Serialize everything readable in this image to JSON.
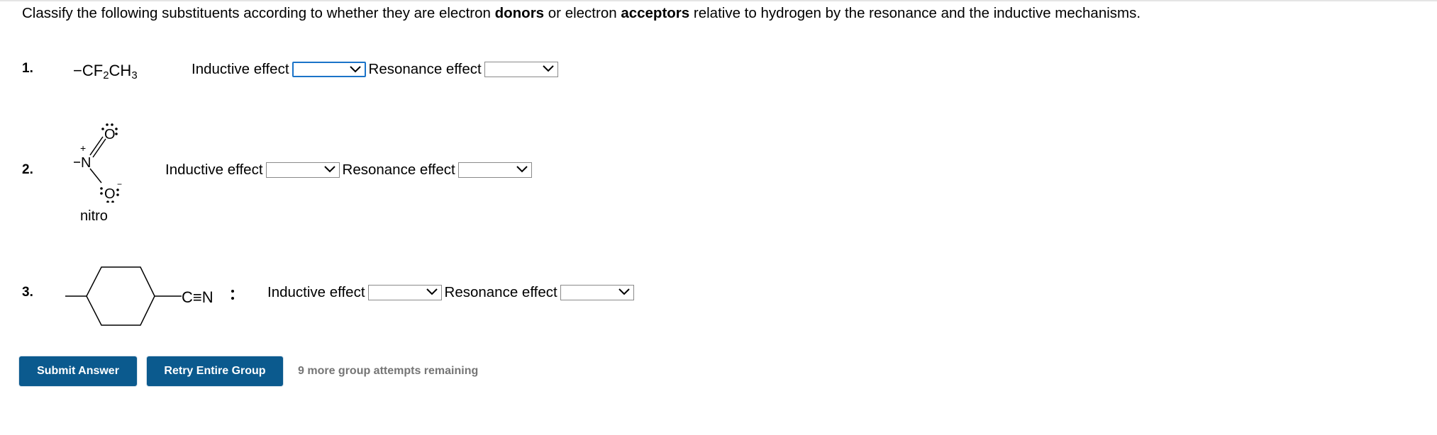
{
  "instructions": {
    "part1": "Classify the following substituents according to whether they are electron ",
    "donors": "donors",
    "part2": " or electron ",
    "acceptors": "acceptors",
    "part3": " relative to hydrogen by the resonance and the inductive mechanisms."
  },
  "questions": [
    {
      "number": "1.",
      "formula": {
        "dash": "−",
        "c1": "CF",
        "s1": "2",
        "c2": "CH",
        "s2": "3"
      },
      "inductive_label": "Inductive effect",
      "inductive_value": "",
      "resonance_label": "Resonance effect",
      "resonance_value": ""
    },
    {
      "number": "2.",
      "structure": {
        "o_top": "O",
        "n": "N",
        "o_bottom": "O",
        "plus": "+",
        "minus": "−",
        "name": "nitro"
      },
      "inductive_label": "Inductive effect",
      "inductive_value": "",
      "resonance_label": "Resonance effect",
      "resonance_value": ""
    },
    {
      "number": "3.",
      "structure": {
        "group": "C≡N"
      },
      "inductive_label": "Inductive effect",
      "inductive_value": "",
      "resonance_label": "Resonance effect",
      "resonance_value": ""
    }
  ],
  "buttons": {
    "submit": "Submit Answer",
    "retry": "Retry Entire Group"
  },
  "attempts_text": "9 more group attempts remaining",
  "colors": {
    "button": "#0b5a8e",
    "focus": "#1a73c8",
    "muted": "#757575"
  }
}
